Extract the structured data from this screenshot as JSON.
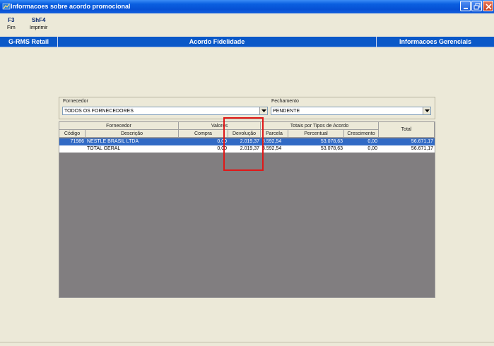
{
  "window": {
    "title": "Informacoes sobre acordo promocional"
  },
  "toolbar": {
    "f3": {
      "key": "F3",
      "label": "Fim"
    },
    "shf4": {
      "key": "ShF4",
      "label": "Imprimir"
    }
  },
  "header_bar": {
    "left": "G-RMS Retail",
    "center": "Acordo Fidelidade",
    "right": "Informacoes Gerenciais"
  },
  "filters": {
    "fornecedor": {
      "label": "Fornecedor",
      "value": "TODOS OS FORNECEDORES"
    },
    "fechamento": {
      "label": "Fechamento",
      "value": "PENDENTE"
    }
  },
  "grid": {
    "group_headers": {
      "fornecedor": "Fornecedor",
      "valores": "Valores",
      "totais": "Totais por Tipos de Acordo",
      "total": "Total"
    },
    "columns": [
      "Código",
      "Descrição",
      "Compra",
      "Devolução",
      "Parcela",
      "Percentual",
      "Crescimento"
    ],
    "rows": [
      {
        "codigo": "71986",
        "descricao": "NESTLE BRASIL LTDA",
        "compra": "0,00",
        "devolucao": "2.019,37",
        "parcela": "3.592,54",
        "percentual": "53.078,63",
        "crescimento": "0,00",
        "total": "56.671,17"
      },
      {
        "codigo": "",
        "descricao": "TOTAL GERAL",
        "compra": "0,00",
        "devolucao": "2.019,37",
        "parcela": "3.592,54",
        "percentual": "53.078,63",
        "crescimento": "0,00",
        "total": "56.671,17"
      }
    ]
  },
  "colors": {
    "titlebar": "#0a5fe0",
    "header_bar": "#0a58c8",
    "selection": "#316ac5",
    "grid_background": "#817e80",
    "highlight_box": "#e01818"
  }
}
